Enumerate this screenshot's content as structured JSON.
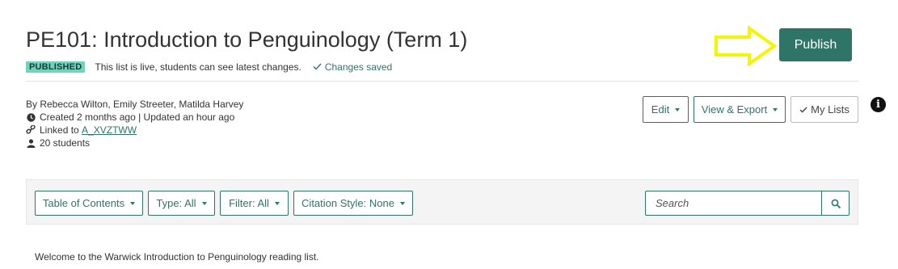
{
  "header": {
    "title": "PE101: Introduction to Penguinology (Term 1)",
    "status_badge": "PUBLISHED",
    "status_text": "This list is live, students can see latest changes.",
    "saved_text": "Changes saved",
    "publish_label": "Publish"
  },
  "meta": {
    "authors": "By Rebecca Wilton, Emily Streeter, Matilda Harvey",
    "dates": "Created 2 months ago | Updated an hour ago",
    "linked_prefix": "Linked to",
    "linked_code": "A_XVZTWW",
    "students": "20 students"
  },
  "actions": {
    "edit": "Edit",
    "view_export": "View & Export",
    "my_lists": "My Lists"
  },
  "toolbar": {
    "toc": "Table of Contents",
    "type": "Type: All",
    "filter": "Filter: All",
    "citation": "Citation Style: None",
    "search_placeholder": "Search"
  },
  "content": {
    "welcome": "Welcome to the Warwick Introduction to Penguinology reading list."
  },
  "colors": {
    "accent": "#2e7467",
    "badge": "#6fd3bd",
    "annotation_arrow": "#f5f500"
  },
  "icons": [
    "check-icon",
    "clock-icon",
    "link-icon",
    "user-icon",
    "info-icon",
    "search-icon",
    "caret-down-icon",
    "arrow-annotation-icon"
  ]
}
